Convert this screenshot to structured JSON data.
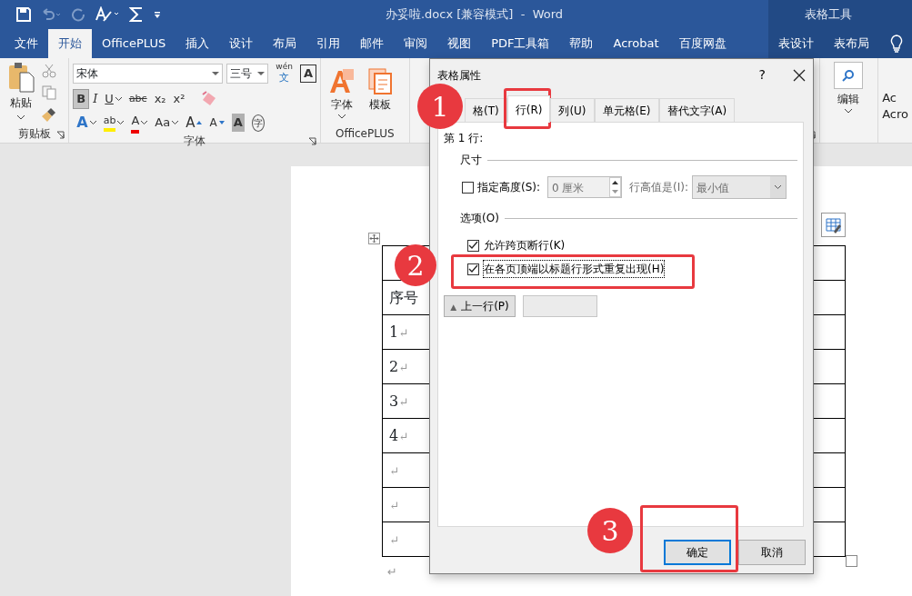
{
  "title_bar": {
    "title": "办妥啦.docx [兼容模式]  -  Word",
    "context_label": "表格工具"
  },
  "quick_access": [
    {
      "kind": "save",
      "disabled": false
    },
    {
      "kind": "undo",
      "disabled": true
    },
    {
      "kind": "redo",
      "disabled": true
    },
    {
      "kind": "spelling",
      "disabled": false
    },
    {
      "kind": "sum",
      "disabled": false
    },
    {
      "kind": "customize",
      "disabled": false
    }
  ],
  "ribbon_tabs": [
    {
      "label": "文件",
      "selected": false,
      "contextual": false
    },
    {
      "label": "开始",
      "selected": true,
      "contextual": false
    },
    {
      "label": "OfficePLUS",
      "selected": false,
      "contextual": false
    },
    {
      "label": "插入",
      "selected": false,
      "contextual": false
    },
    {
      "label": "设计",
      "selected": false,
      "contextual": false
    },
    {
      "label": "布局",
      "selected": false,
      "contextual": false
    },
    {
      "label": "引用",
      "selected": false,
      "contextual": false
    },
    {
      "label": "邮件",
      "selected": false,
      "contextual": false
    },
    {
      "label": "审阅",
      "selected": false,
      "contextual": false
    },
    {
      "label": "视图",
      "selected": false,
      "contextual": false
    },
    {
      "label": "PDF工具箱",
      "selected": false,
      "contextual": false
    },
    {
      "label": "帮助",
      "selected": false,
      "contextual": false
    },
    {
      "label": "Acrobat",
      "selected": false,
      "contextual": false
    },
    {
      "label": "百度网盘",
      "selected": false,
      "contextual": false
    },
    {
      "label": "表设计",
      "selected": false,
      "contextual": true
    },
    {
      "label": "表布局",
      "selected": false,
      "contextual": true
    }
  ],
  "ribbon": {
    "clipboard": {
      "paste": "粘贴",
      "label": "剪贴板"
    },
    "font": {
      "font_name": "宋体",
      "font_size": "三号",
      "label": "字体",
      "row_1": [
        {
          "glyph": "B",
          "kind": "bold",
          "pressed": true,
          "dropdown": false
        },
        {
          "glyph": "I",
          "kind": "italic",
          "pressed": false,
          "dropdown": false
        },
        {
          "glyph": "U",
          "kind": "underline",
          "pressed": false,
          "dropdown": true
        },
        {
          "glyph": "abc",
          "kind": "strike",
          "pressed": false,
          "dropdown": false
        },
        {
          "glyph": "x₂",
          "kind": "plain",
          "pressed": false,
          "dropdown": false
        },
        {
          "glyph": "x²",
          "kind": "plain",
          "pressed": false,
          "dropdown": false
        }
      ],
      "row_2": [
        {
          "glyph": "A",
          "kind": "effect",
          "pressed": false,
          "dropdown": true
        },
        {
          "glyph": "ab",
          "kind": "highlight",
          "pressed": false,
          "dropdown": true
        },
        {
          "glyph": "A",
          "kind": "color",
          "pressed": false,
          "dropdown": true
        },
        {
          "glyph": "Aa",
          "kind": "plain",
          "pressed": false,
          "dropdown": true
        },
        {
          "glyph": "A",
          "kind": "grow",
          "pressed": false,
          "dropdown": false
        },
        {
          "glyph": "A",
          "kind": "shrink",
          "pressed": false,
          "dropdown": false
        },
        {
          "glyph": "A",
          "kind": "shaded",
          "pressed": false,
          "dropdown": false
        },
        {
          "glyph": "字",
          "kind": "enclosed",
          "pressed": false,
          "dropdown": false
        }
      ],
      "phonetic_top": "wén",
      "phonetic_base": "文",
      "border_glyph": "A"
    },
    "officeplus": {
      "label": "OfficePLUS",
      "items": [
        {
          "label": "字体",
          "kind": "font"
        },
        {
          "label": "模板",
          "kind": "template"
        }
      ]
    },
    "editing": {
      "label": "编辑"
    },
    "cut_group": {
      "line_1": "Ac",
      "line_2": "Acro"
    }
  },
  "document": {
    "rows": [
      {},
      {
        "text": "序号"
      },
      {
        "text": "1",
        "mark": "↵"
      },
      {
        "text": "2",
        "mark": "↵"
      },
      {
        "text": "3",
        "mark": "↵"
      },
      {
        "text": "4",
        "mark": "↵"
      },
      {
        "mark": "↵"
      },
      {
        "mark": "↵"
      },
      {
        "mark": "↵"
      }
    ],
    "after_table_mark": "↵"
  },
  "dialog": {
    "title": "表格属性",
    "help": "?",
    "tabs": [
      {
        "label": "格(T)",
        "selected": false,
        "step": "1",
        "highlighted": false
      },
      {
        "label": "行(R)",
        "selected": true,
        "highlighted": true
      },
      {
        "label": "列(U)",
        "selected": false,
        "highlighted": false
      },
      {
        "label": "单元格(E)",
        "selected": false,
        "highlighted": false
      },
      {
        "label": "替代文字(A)",
        "selected": false,
        "highlighted": false
      }
    ],
    "row_heading": "第 1 行:",
    "size_section": {
      "label": "尺寸",
      "specify_height": {
        "label": "指定高度(S):",
        "checked": false
      },
      "height_value": "0 厘米",
      "row_height_label": "行高值是(I):",
      "row_height_mode": "最小值",
      "disabled": true
    },
    "options_section": {
      "label": "选项(O)",
      "options": [
        {
          "label": "允许跨页断行(K)",
          "checked": true,
          "focused": false,
          "highlighted": false
        },
        {
          "label": "在各页顶端以标题行形式重复出现(H)",
          "checked": true,
          "focused": true,
          "highlighted": true,
          "step": "2"
        }
      ]
    },
    "nav_buttons": [
      {
        "kind": "previous",
        "label": "上一行(P)",
        "arrow": "▲",
        "disabled": false
      },
      {
        "kind": "next",
        "disabled": true
      }
    ],
    "footer_buttons": [
      {
        "label": "确定",
        "default": true,
        "highlighted": true,
        "step": "3"
      },
      {
        "label": "取消",
        "default": false,
        "highlighted": false
      }
    ]
  }
}
